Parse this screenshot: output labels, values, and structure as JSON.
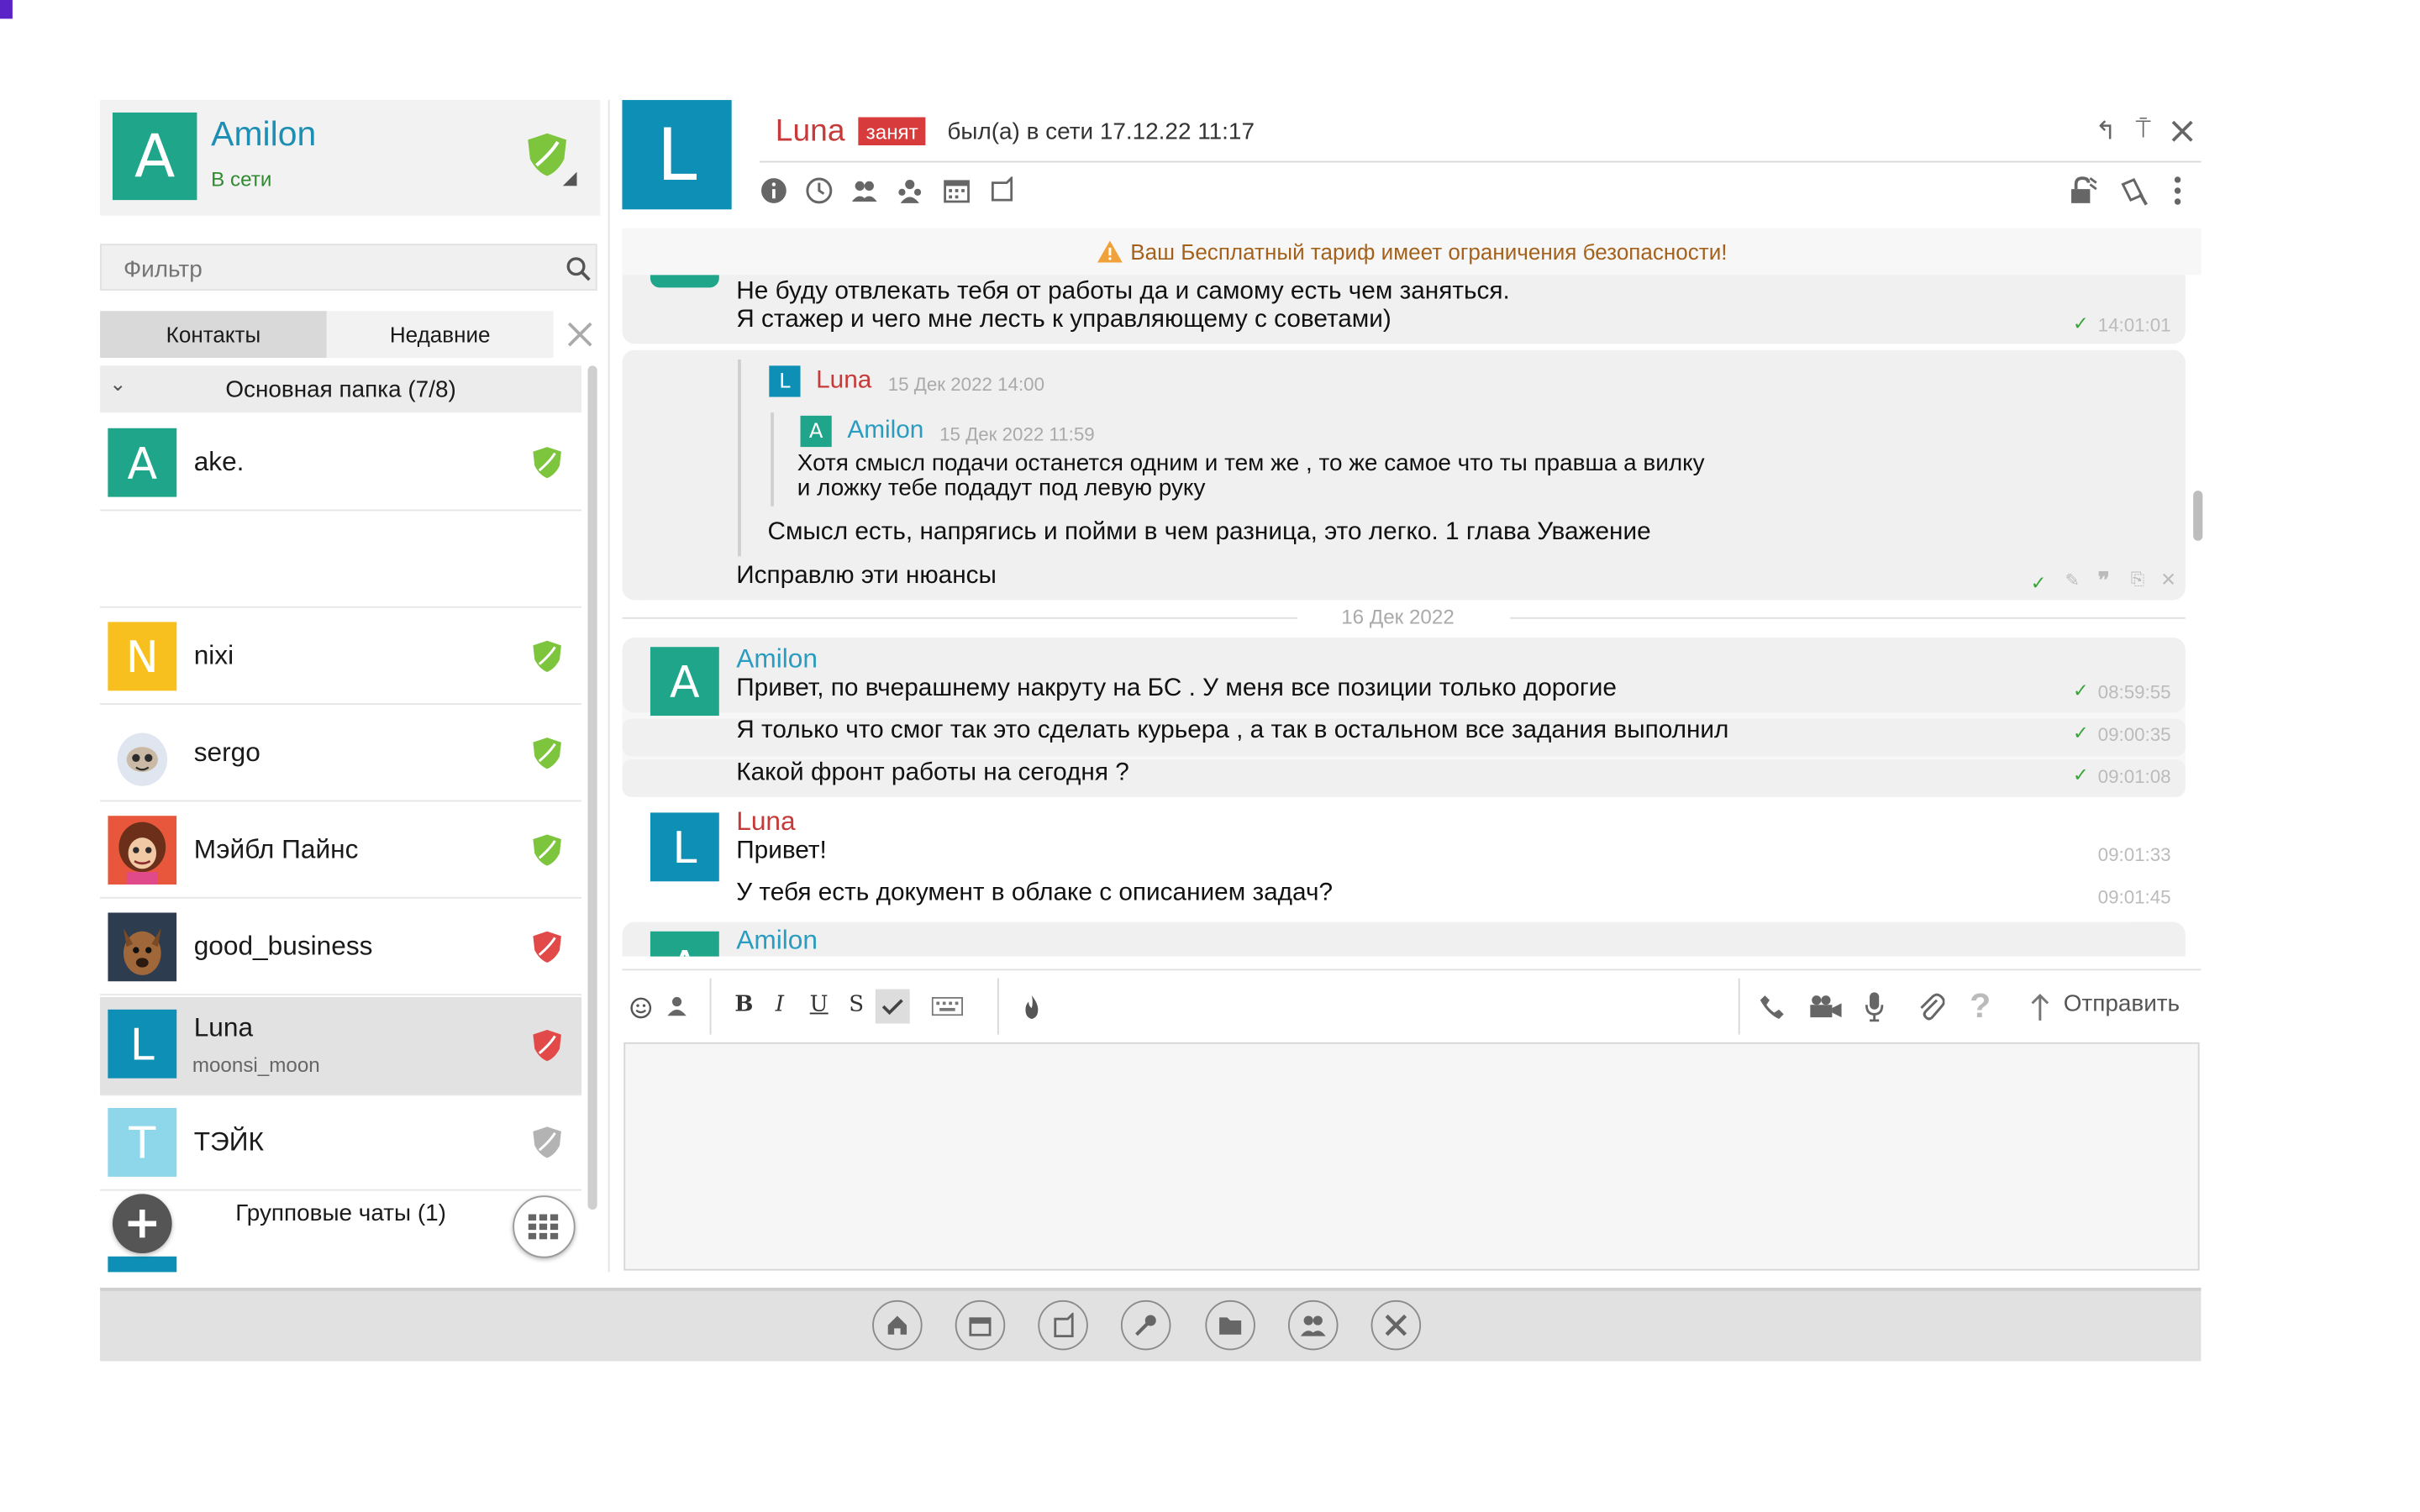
{
  "profile": {
    "initial": "A",
    "name": "Amilon",
    "status": "В сети",
    "color": "#1fa58a"
  },
  "filter": {
    "placeholder": "Фильтр"
  },
  "tabs": {
    "contacts": "Контакты",
    "recent": "Недавние"
  },
  "folder": {
    "label": "Основная папка (7/8)"
  },
  "contacts": [
    {
      "initial": "A",
      "name": "ake.",
      "shield": "green"
    },
    {
      "initial": "N",
      "name": "nixi",
      "shield": "green"
    },
    {
      "initial": "",
      "name": "sergo",
      "shield": "green"
    },
    {
      "initial": "",
      "name": "Мэйбл Пайнс",
      "shield": "green"
    },
    {
      "initial": "",
      "name": "good_business",
      "shield": "red"
    },
    {
      "initial": "L",
      "name": "Luna",
      "sub": "moonsi_moon",
      "shield": "red"
    },
    {
      "initial": "T",
      "name": "ТЭЙК",
      "shield": "gray"
    }
  ],
  "groups": {
    "label": "Групповые чаты (1)"
  },
  "chat": {
    "initial": "L",
    "name": "Luna",
    "badge": "занят",
    "last_seen": "был(а) в сети 17.12.22 11:17"
  },
  "banner": {
    "text": "Ваш Бесплатный тариф имеет ограничения безопасности!"
  },
  "messages": {
    "m1": {
      "line1": "Не буду отвлекать тебя от работы да и самому есть чем заняться.",
      "line2": "Я стажер и чего мне лесть к управляющему с советами)",
      "time": "14:01:01"
    },
    "reply": {
      "q1_initial": "L",
      "q1_name": "Luna",
      "q1_date": "15 Дек 2022 14:00",
      "q2_initial": "A",
      "q2_name": "Amilon",
      "q2_date": "15 Дек 2022 11:59",
      "q2_line1": "Хотя смысл подачи останется одним и тем же , то же самое что ты правша а вилку",
      "q2_line2": "и ложку тебе подадут под левую руку",
      "q1_text": "Смысл есть, напрягись и пойми в чем разница, это легко. 1 глава Уважение",
      "text": "Исправлю эти нюансы"
    },
    "date_sep": "16 Дек 2022",
    "g1": {
      "initial": "A",
      "name": "Amilon",
      "items": [
        {
          "text": "Привет, по вчерашнему накруту на БС . У меня все позиции только дорогие",
          "time": "08:59:55"
        },
        {
          "text": "Я только что смог так это сделать курьера , а так в остальном все задания выполнил",
          "time": "09:00:35"
        },
        {
          "text": "Какой фронт работы на сегодня ?",
          "time": "09:01:08"
        }
      ]
    },
    "g2": {
      "initial": "L",
      "name": "Luna",
      "items": [
        {
          "text": "Привет!",
          "time": "09:01:33"
        },
        {
          "text": "У тебя есть документ в облаке с описанием задач?",
          "time": "09:01:45"
        }
      ]
    },
    "g3": {
      "initial": "A",
      "name": "Amilon"
    }
  },
  "toolbar": {
    "bold": "B",
    "italic": "I",
    "underline": "U",
    "strike": "S",
    "send": "Отправить"
  },
  "colors": {
    "teal": "#1fa58a",
    "blue": "#0e8fb5",
    "luna_red": "#c73a3a",
    "amilon_blue": "#2a9cc0",
    "tick_green": "#3aa33a"
  }
}
